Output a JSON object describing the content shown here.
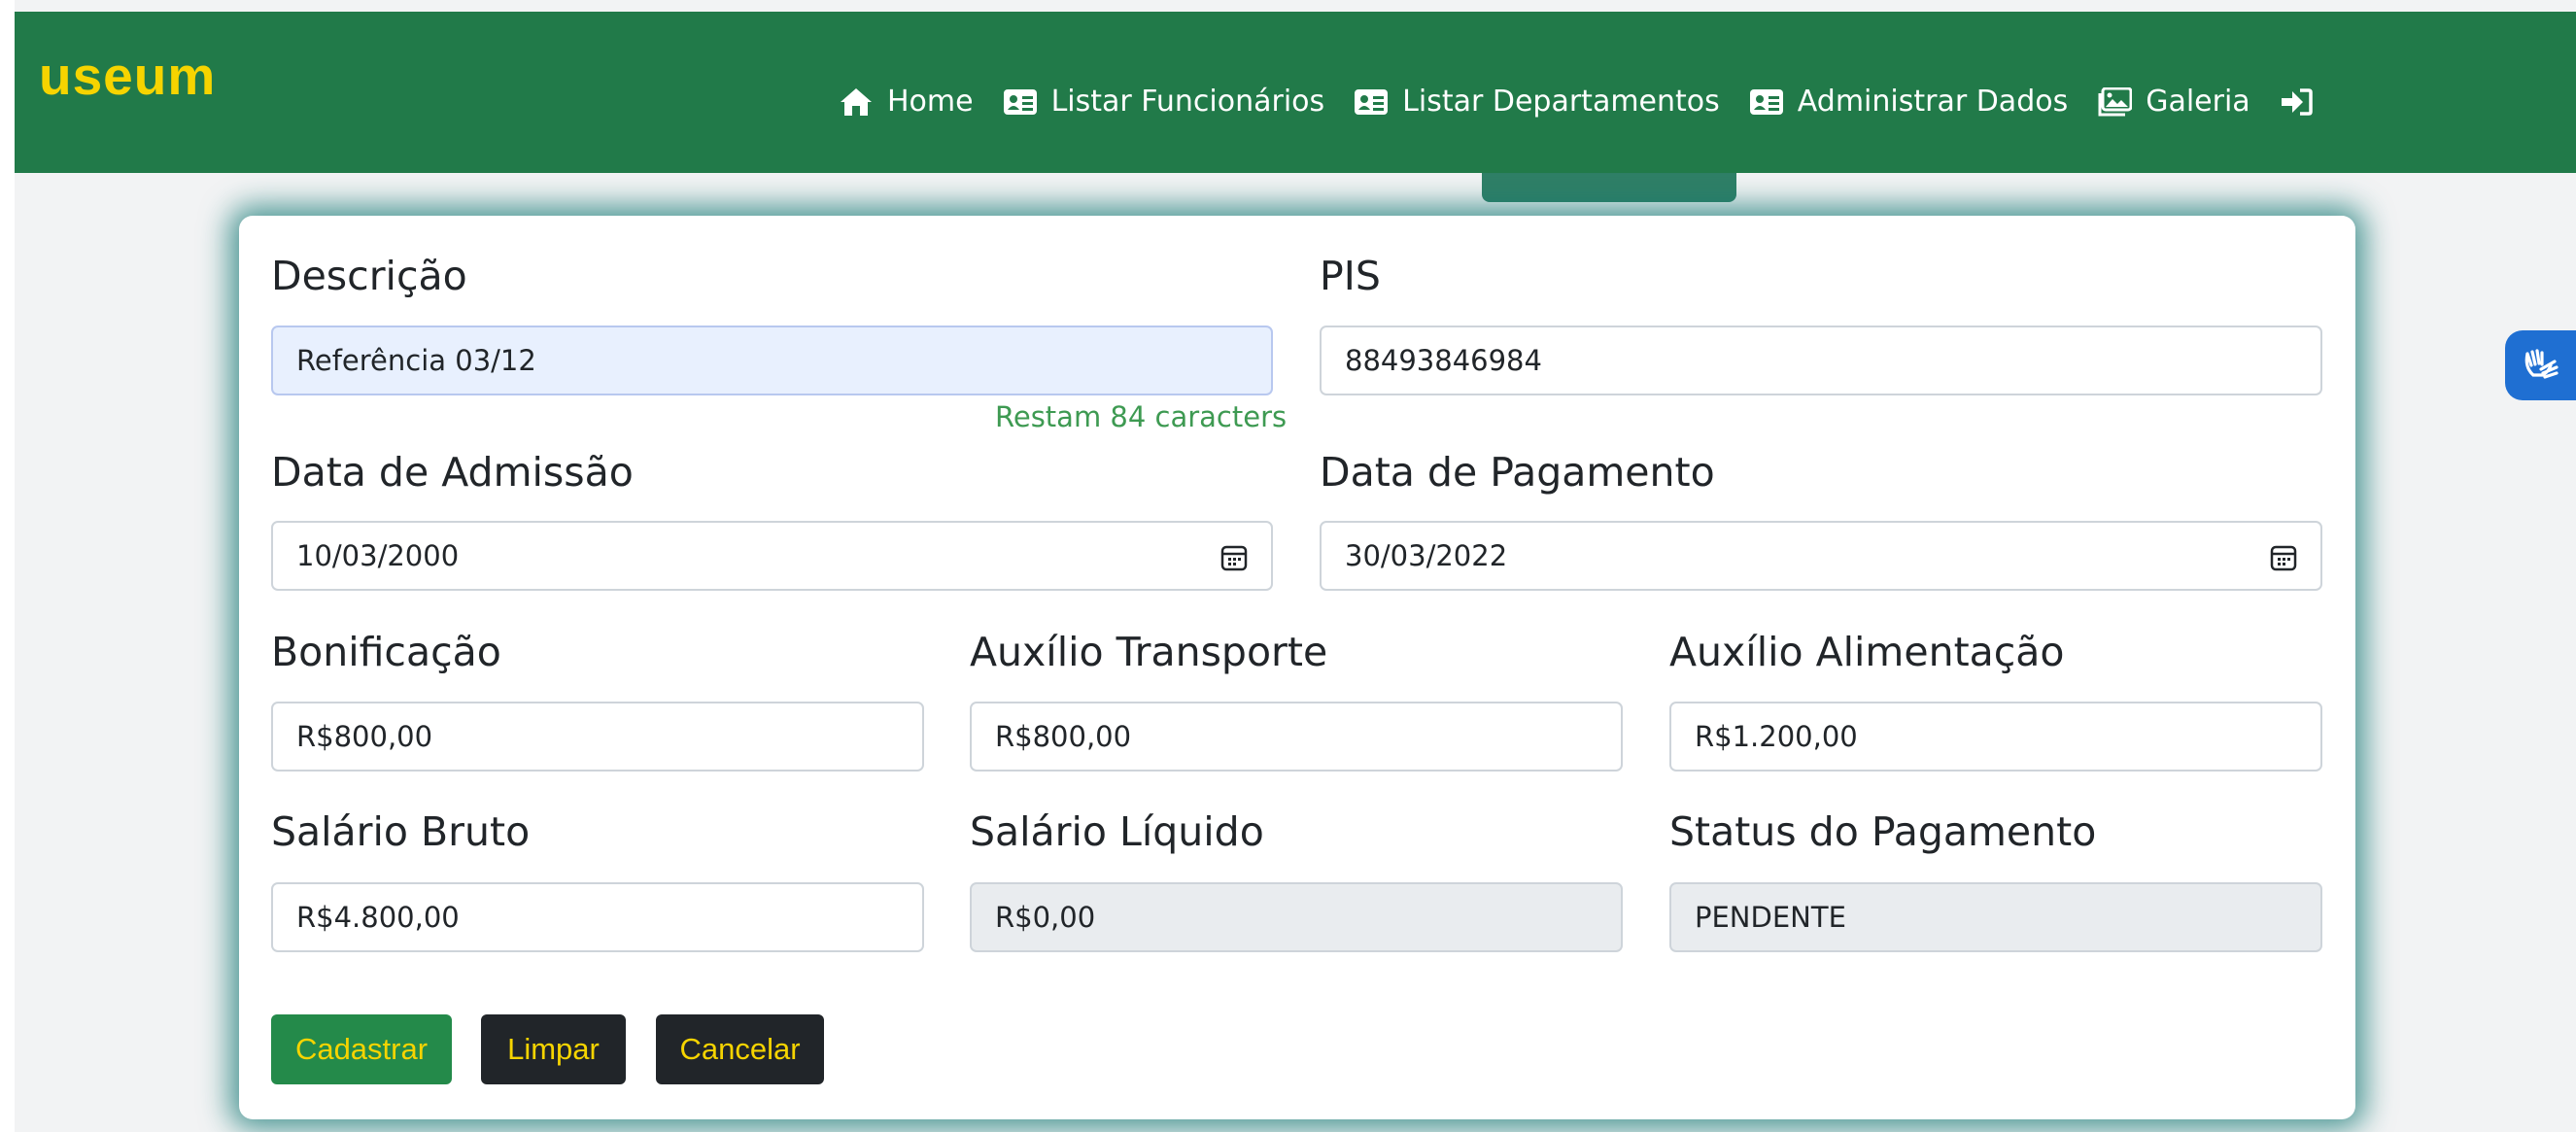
{
  "brand": "useum",
  "nav": {
    "home": "Home",
    "employees": "Listar Funcionários",
    "departments": "Listar Departamentos",
    "admin": "Administrar Dados",
    "gallery": "Galeria"
  },
  "form": {
    "descricao": {
      "label": "Descrição",
      "value": "Referência 03/12",
      "hint": "Restam 84 caracters"
    },
    "pis": {
      "label": "PIS",
      "value": "88493846984"
    },
    "data_admissao": {
      "label": "Data de Admissão",
      "value": "10/03/2000"
    },
    "data_pagamento": {
      "label": "Data de Pagamento",
      "value": "30/03/2022"
    },
    "bonificacao": {
      "label": "Bonificação",
      "value": "R$800,00"
    },
    "auxilio_transporte": {
      "label": "Auxílio Transporte",
      "value": "R$800,00"
    },
    "auxilio_alimentacao": {
      "label": "Auxílio Alimentação",
      "value": "R$1.200,00"
    },
    "salario_bruto": {
      "label": "Salário Bruto",
      "value": "R$4.800,00"
    },
    "salario_liquido": {
      "label": "Salário Líquido",
      "value": "R$0,00"
    },
    "status_pagamento": {
      "label": "Status do Pagamento",
      "value": "PENDENTE"
    }
  },
  "buttons": {
    "submit": "Cadastrar",
    "clear": "Limpar",
    "cancel": "Cancelar"
  },
  "colors": {
    "navbar": "#217a49",
    "brand_text": "#f6d400",
    "button_text": "#f6d400",
    "submit_button": "#248a4a",
    "dark_button": "#212529",
    "hint_text": "#3e9a52",
    "card_glow": "#167a76"
  },
  "icons": {
    "home": "home-icon",
    "employees": "id-card-icon",
    "departments": "id-card-icon",
    "admin": "id-card-icon",
    "gallery": "image-icon",
    "login": "sign-in-icon",
    "date": "calendar-icon",
    "accessibility": "sign-language-hands-icon"
  }
}
